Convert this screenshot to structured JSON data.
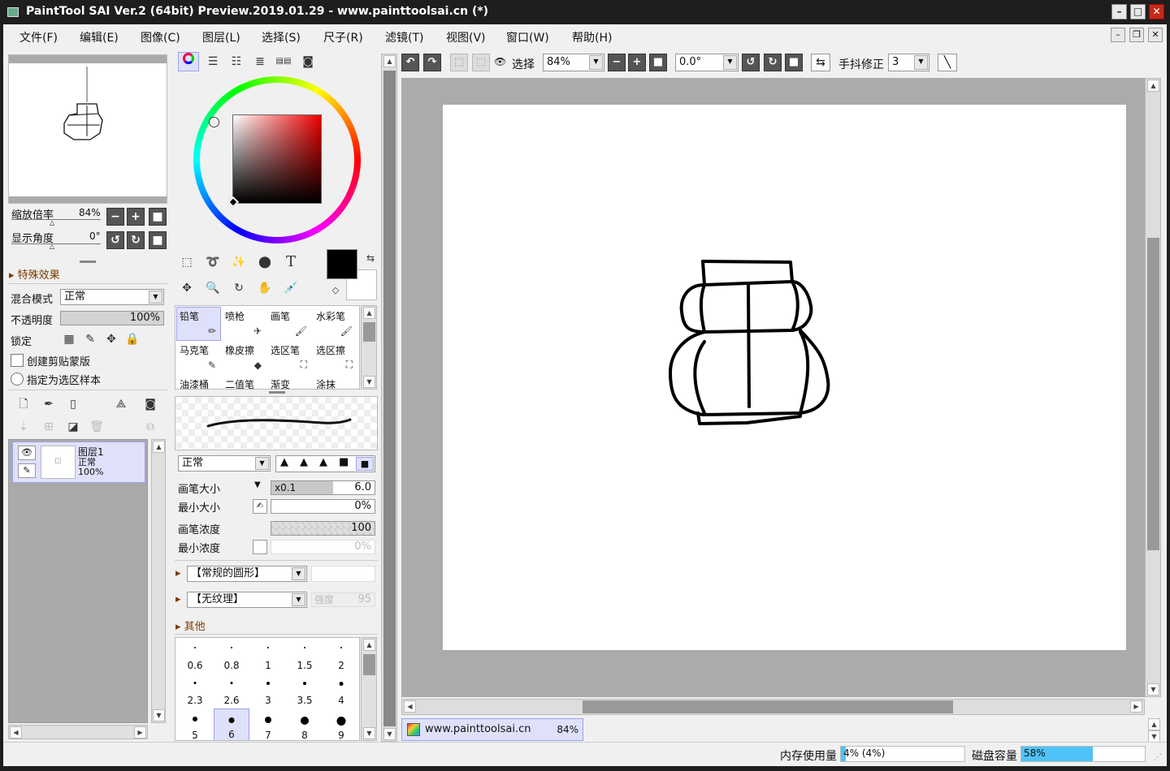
{
  "window": {
    "title": "PaintTool SAI Ver.2 (64bit) Preview.2019.01.29 - www.painttoolsai.cn (*)",
    "min": "–",
    "max": "□",
    "close": "✕"
  },
  "menu": [
    "文件(F)",
    "编辑(E)",
    "图像(C)",
    "图层(L)",
    "选择(S)",
    "尺子(R)",
    "滤镜(T)",
    "视图(V)",
    "窗口(W)",
    "帮助(H)"
  ],
  "mdi": {
    "min": "–",
    "restore": "❐",
    "close": "✕"
  },
  "navigator": {
    "zoom_label": "缩放倍率",
    "zoom_value": "84%",
    "angle_label": "显示角度",
    "angle_value": "0°"
  },
  "layer_props": {
    "effects": "特殊效果",
    "blend_label": "混合模式",
    "blend_value": "正常",
    "opacity_label": "不透明度",
    "opacity_value": "100%",
    "opacity": 1.0,
    "lock_label": "锁定",
    "clip_label": "创建剪贴蒙版",
    "sample_label": "指定为选区样本"
  },
  "layers": [
    {
      "name": "图层1",
      "mode": "正常",
      "opacity": "100%"
    }
  ],
  "colors": {
    "accent": "#9aa3ee",
    "selected_bg": "#dfe1fb",
    "primary": "#000000",
    "secondary": "#ffffff",
    "canvas_bg": "#ababab"
  },
  "tools": {
    "text_tool": "T"
  },
  "brushes": [
    {
      "name": "铅笔",
      "selected": true
    },
    {
      "name": "喷枪"
    },
    {
      "name": "画笔"
    },
    {
      "name": "水彩笔"
    },
    {
      "name": "马克笔"
    },
    {
      "name": "橡皮擦"
    },
    {
      "name": "选区笔"
    },
    {
      "name": "选区擦"
    },
    {
      "name": "油漆桶"
    },
    {
      "name": "二值笔"
    },
    {
      "name": "渐变"
    },
    {
      "name": "涂抹"
    }
  ],
  "brush_settings": {
    "mode": "正常",
    "size_label": "画笔大小",
    "size_mult": "x0.1",
    "size_value": "6.0",
    "min_size_label": "最小大小",
    "min_size_value": "0%",
    "density_label": "画笔浓度",
    "density_value": "100",
    "min_density_label": "最小浓度",
    "min_density_value": "0%",
    "shape": "【常规的圆形】",
    "texture": "【无纹理】",
    "strength_label": "强度",
    "strength_value": "95",
    "other": "其他"
  },
  "brush_sizes": [
    "0.6",
    "0.8",
    "1",
    "1.5",
    "2",
    "2.3",
    "2.6",
    "3",
    "3.5",
    "4",
    "5",
    "6",
    "7",
    "8",
    "9"
  ],
  "toolbar": {
    "select_label": "选择",
    "zoom": "84%",
    "angle": "0.0°",
    "stabilizer_label": "手抖修正",
    "stabilizer_value": "3"
  },
  "doc_tab": {
    "name": "www.painttoolsai.cn",
    "zoom": "84%"
  },
  "status": {
    "mem_label": "内存使用量",
    "mem_value": "4% (4%)",
    "mem": 0.04,
    "disk_label": "磁盘容量",
    "disk_value": "58%",
    "disk": 0.58
  }
}
